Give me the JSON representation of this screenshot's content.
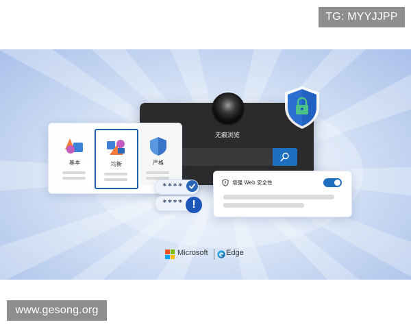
{
  "watermarks": {
    "top_right": "TG: MYYJJPP",
    "bottom_left": "www.gesong.org"
  },
  "incognito_window": {
    "title": "无痕浏览",
    "avatar_icon": "incognito-avatar",
    "search_icon": "search-icon",
    "search_button_color": "#1f6fc1"
  },
  "shield": {
    "icon": "lock-shield-icon",
    "color": "#2a6fd0",
    "lock_color": "#4cc38a"
  },
  "tracking_prevention": {
    "options": [
      {
        "label": "基本",
        "icon": "basic-shapes-icon",
        "selected": false
      },
      {
        "label": "均衡",
        "icon": "balanced-shapes-icon",
        "selected": true
      },
      {
        "label": "严格",
        "icon": "strict-shield-icon",
        "selected": false
      }
    ],
    "selected_border_color": "#1f5fa8"
  },
  "password_monitor": {
    "items": [
      {
        "masked": "****",
        "status_icon": "check-icon"
      },
      {
        "masked": "****",
        "status_icon": "alert-icon",
        "status_glyph": "!"
      }
    ]
  },
  "safe_web": {
    "icon": "shield-outline-icon",
    "label": "增强 Web 安全性",
    "toggle_on": true,
    "toggle_color": "#1f6fc1"
  },
  "brand": {
    "microsoft": "Microsoft",
    "edge": "Edge",
    "logo_colors": [
      "#f25022",
      "#7fba00",
      "#00a4ef",
      "#ffb900"
    ]
  }
}
